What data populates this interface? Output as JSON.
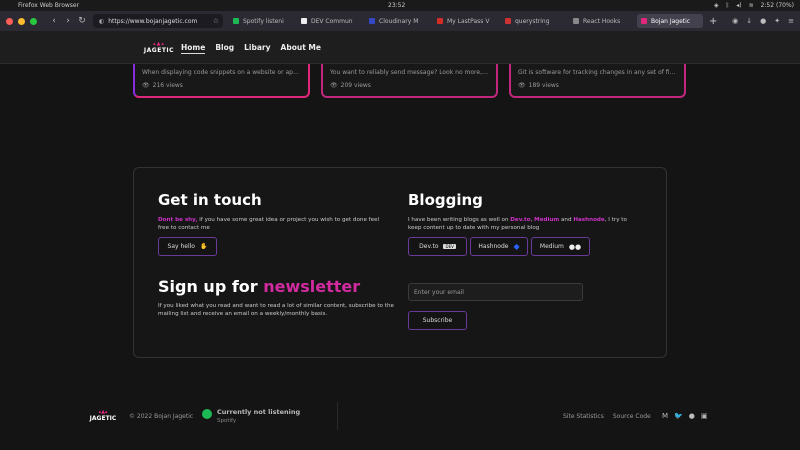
{
  "os": {
    "app_name": "Firefox Web Browser",
    "clock": "23:52",
    "battery": "2:52 (70%)"
  },
  "browser": {
    "url": "https://www.bojanjagetic.com",
    "tabs": [
      {
        "label": "Spotify listeni",
        "color": "#1db954"
      },
      {
        "label": "DEV Commun",
        "color": "#111111"
      },
      {
        "label": "Cloudinary M",
        "color": "#3448c5"
      },
      {
        "label": "My LastPass V",
        "color": "#d32d27"
      },
      {
        "label": "querystring",
        "color": "#cc3333"
      },
      {
        "label": "React Hooks",
        "color": "#888888"
      },
      {
        "label": "Bojan Jagetic",
        "color": "#e0267d"
      }
    ]
  },
  "header": {
    "logo_text": "JAGETIC",
    "nav": [
      "Home",
      "Blog",
      "Libary",
      "About Me"
    ]
  },
  "cards": [
    {
      "desc": "When displaying code snippets on a website or applic...",
      "views": "216 views"
    },
    {
      "desc": "You want to reliably send message? Look no more, fir...",
      "views": "209 views"
    },
    {
      "desc": "Git is software for tracking changes in any set of files, ...",
      "views": "189 views"
    }
  ],
  "contact": {
    "title": "Get in touch",
    "intro_highlight": "Dont be shy,",
    "intro_rest": " if you have some great idea or project you wish to get done feel free to contact me",
    "say_hello": "Say hello"
  },
  "blogging": {
    "title": "Blogging",
    "text_1": "I have been writing blogs as well on ",
    "dev": "Dev.to",
    "sep_1": ", ",
    "medium": "Medium",
    "sep_2": " and ",
    "hashnode": "Hashnode",
    "text_2": ", I try to keep content up to date with my personal blog",
    "buttons": [
      "Dev.to",
      "Hashnode",
      "Medium"
    ]
  },
  "newsletter": {
    "title_main": "Sign up for ",
    "title_accent": "newsletter",
    "text": "If you liked what you read and want to read a lot of similar content, subscribe to the mailing list and receive an email on a weekly/monthly basis.",
    "email_placeholder": "Enter your email",
    "subscribe": "Subscribe"
  },
  "footer": {
    "logo_text": "JAGETIC",
    "copyright": "© 2022 Bojan Jagetic",
    "spotify_status": "Currently not listening",
    "spotify_label": "Spotify",
    "links": [
      "Site Statistics",
      "Source Code"
    ]
  }
}
